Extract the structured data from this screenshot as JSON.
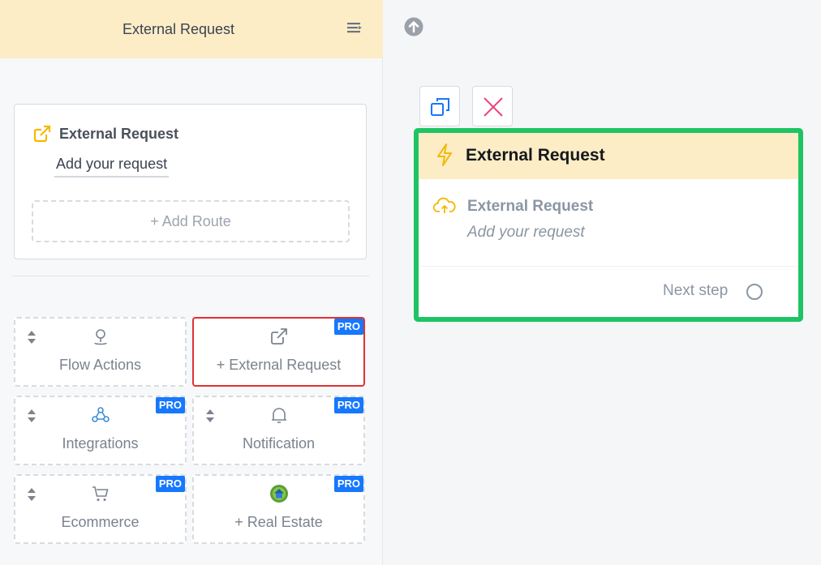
{
  "sidebar": {
    "title": "External Request",
    "card": {
      "title": "External Request",
      "request_value": "Add your request",
      "add_route_label": "+ Add Route"
    },
    "tiles": [
      {
        "label": "Flow Actions",
        "icon": "map-pin-icon",
        "pro": ""
      },
      {
        "label": "+ External Request",
        "icon": "external-link-icon",
        "pro": "PRO"
      },
      {
        "label": "Integrations",
        "icon": "webhook-icon",
        "pro": "PRO"
      },
      {
        "label": "Notification",
        "icon": "bell-icon",
        "pro": "PRO"
      },
      {
        "label": "Ecommerce",
        "icon": "cart-icon",
        "pro": "PRO"
      },
      {
        "label": "+ Real Estate",
        "icon": "house-icon",
        "pro": "PRO"
      }
    ]
  },
  "canvas": {
    "node": {
      "header_title": "External Request",
      "step_title": "External Request",
      "step_subtitle": "Add your request",
      "next_step_label": "Next step"
    }
  },
  "colors": {
    "header_bg": "#fcedc7",
    "accent_blue": "#1677ff",
    "selected_border": "#e03131",
    "node_border": "#1ec463",
    "warning_yellow": "#f5b800",
    "delete_pink": "#e8457a"
  }
}
